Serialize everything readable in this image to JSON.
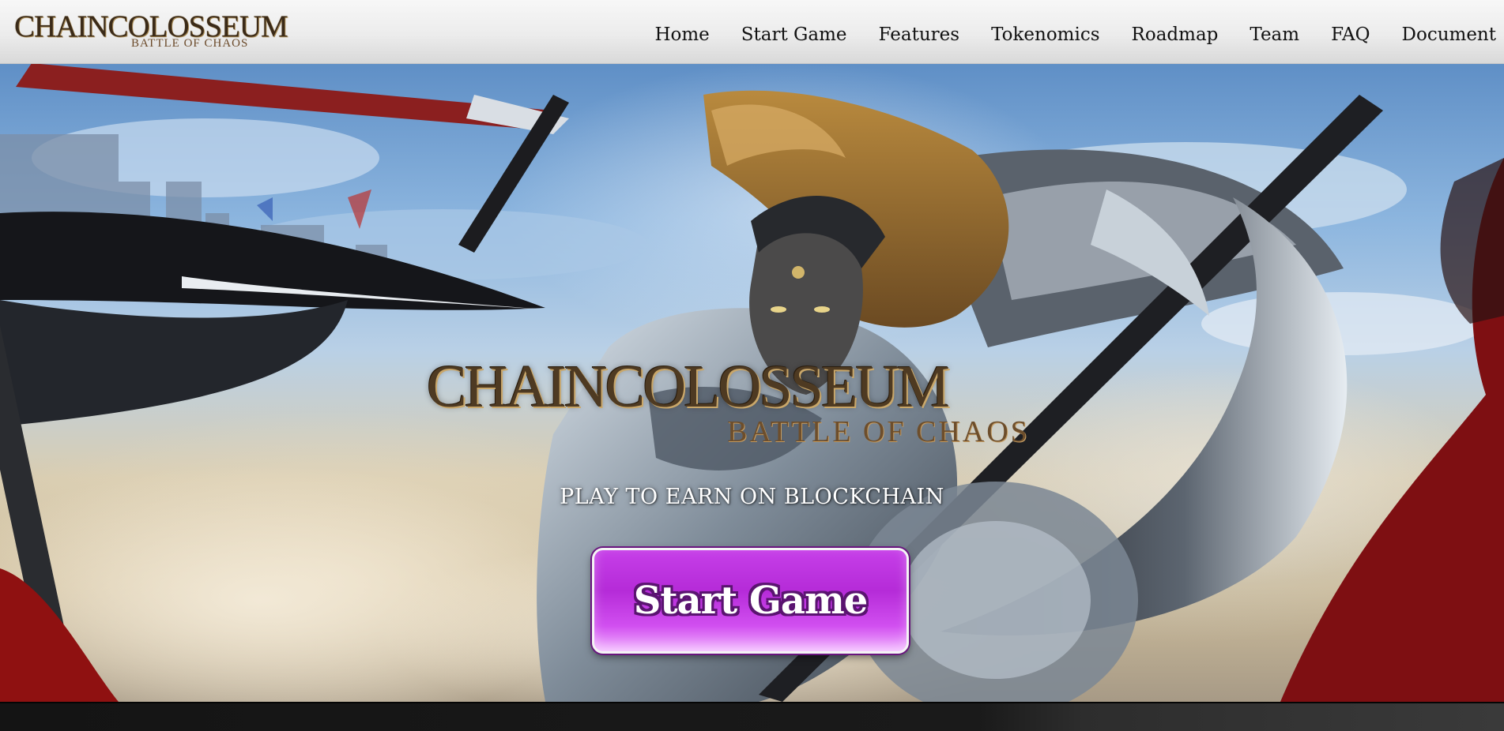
{
  "header": {
    "logo": {
      "top": "CHAINCOLOSSEUM",
      "sub": "BATTLE OF CHAOS"
    },
    "nav": [
      "Home",
      "Start Game",
      "Features",
      "Tokenomics",
      "Roadmap",
      "Team",
      "FAQ",
      "Document"
    ]
  },
  "hero": {
    "logo": {
      "top": "CHAINCOLOSSEUM",
      "sub": "BATTLE OF CHAOS"
    },
    "tagline": "PLAY TO EARN ON BLOCKCHAIN",
    "cta_label": "Start Game"
  },
  "colors": {
    "cta": "#c63fe8",
    "cta_border": "#5a1470",
    "logo_gold": "#c9a76a",
    "header_bg": "#ececec"
  }
}
